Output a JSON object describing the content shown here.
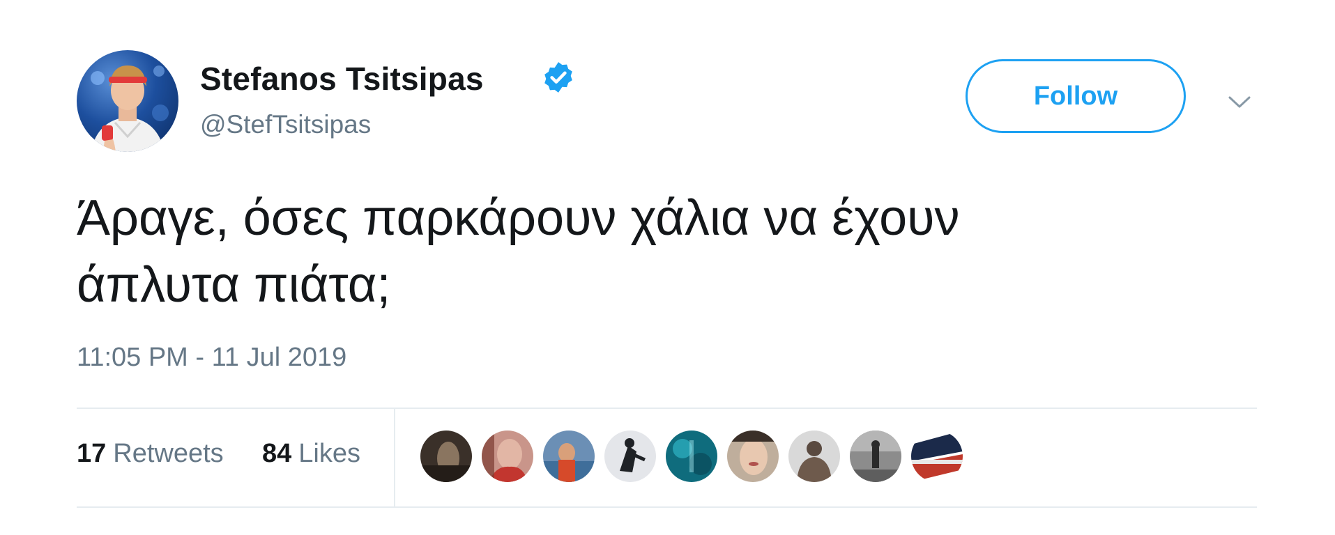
{
  "tweet": {
    "author": {
      "name": "Stefanos Tsitsipas",
      "handle": "@StefTsitsipas",
      "verified": true,
      "avatar_icon": "profile-photo"
    },
    "follow_label": "Follow",
    "menu_icon": "chevron-down-icon",
    "text_lines": [
      "Άραγε, όσες παρκάρουν χάλια να έχουν",
      "άπλυτα πιάτα;"
    ],
    "timestamp": "11:05 PM - 11 Jul 2019",
    "stats": {
      "retweets": {
        "count": "17",
        "label": "Retweets"
      },
      "likes": {
        "count": "84",
        "label": "Likes"
      }
    },
    "liker_avatar_count": 9
  },
  "colors": {
    "accent": "#1da1f2",
    "text": "#14171a",
    "secondary": "#657786",
    "divider": "#e6ecf0"
  }
}
